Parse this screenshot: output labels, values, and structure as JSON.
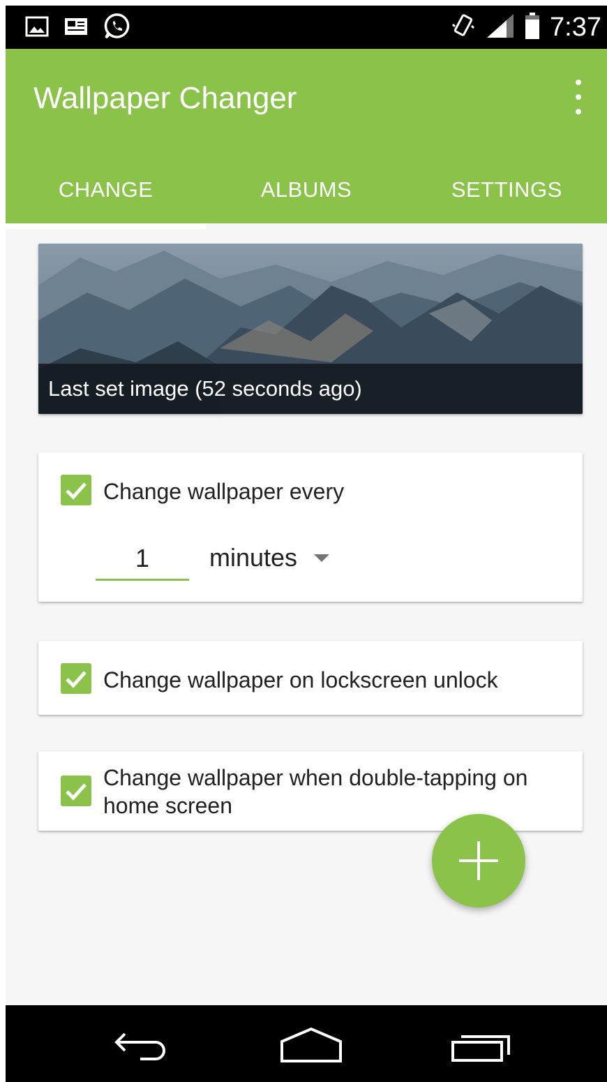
{
  "status_bar": {
    "time": "7:37",
    "icons": [
      "image-icon",
      "news-icon",
      "whatsapp-icon",
      "vibrate-icon",
      "signal-icon",
      "battery-icon"
    ]
  },
  "app_bar": {
    "title": "Wallpaper Changer",
    "overflow_icon": "more-vertical-icon"
  },
  "tabs": [
    {
      "label": "CHANGE",
      "active": true
    },
    {
      "label": "ALBUMS",
      "active": false
    },
    {
      "label": "SETTINGS",
      "active": false
    }
  ],
  "last_image": {
    "caption": "Last set image (52 seconds ago)"
  },
  "options": {
    "interval": {
      "label": "Change wallpaper every",
      "checked": true,
      "value": "1",
      "unit": "minutes"
    },
    "unlock": {
      "label": "Change wallpaper on lockscreen unlock",
      "checked": true
    },
    "double_tap": {
      "label": "Change wallpaper when double-tapping on home screen",
      "checked": true
    }
  },
  "fab": {
    "icon": "plus-icon"
  },
  "nav_bar": {
    "icons": [
      "back-icon",
      "home-icon",
      "recents-icon"
    ]
  },
  "colors": {
    "accent": "#8bc34a",
    "background": "#f6f6f6",
    "text": "#212121"
  }
}
